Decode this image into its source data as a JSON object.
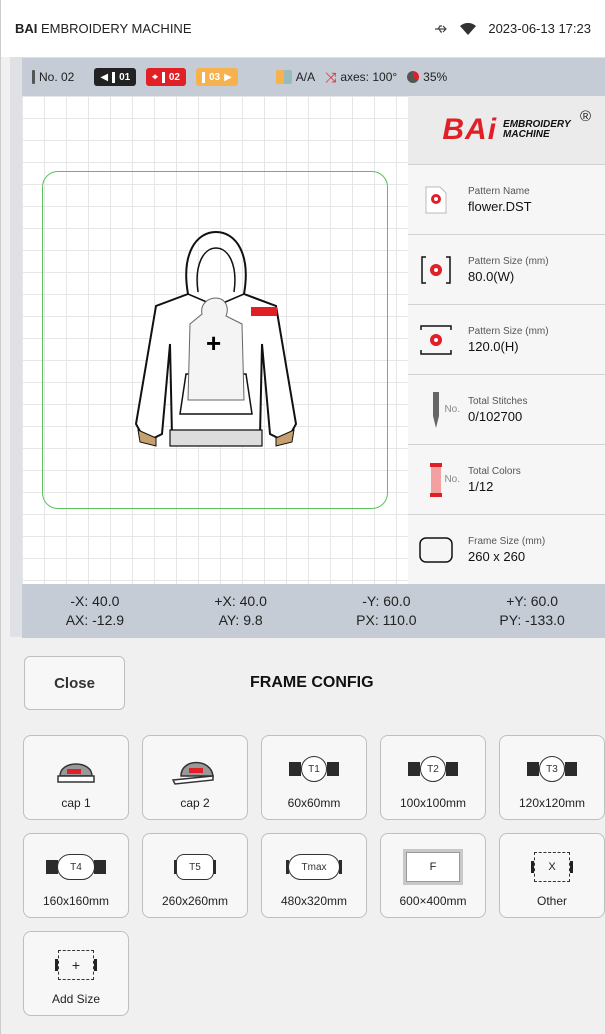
{
  "status": {
    "brand_bold": "BAI",
    "brand_rest": " EMBROIDERY MACHINE",
    "datetime": "2023-06-13 17:23",
    "icons": [
      "usb-icon",
      "wifi-icon"
    ]
  },
  "toolbar": {
    "needle_no": "No. 02",
    "prev_needle": "01",
    "current_needle": "02",
    "next_needle": "03",
    "mode": "A/A",
    "axes": "axes: 100°",
    "percent": "35%"
  },
  "panel": {
    "logo_text": "BAi",
    "logo_sub1": "EMBROIDERY",
    "logo_sub2": "MACHINE",
    "logo_reg": "®",
    "rows": [
      {
        "label": "Pattern Name",
        "value": "flower.DST"
      },
      {
        "label": "Pattern Size (mm)",
        "value": "80.0(W)"
      },
      {
        "label": "Pattern Size (mm)",
        "value": "120.0(H)"
      },
      {
        "label": "Total Stitches",
        "value": "0/102700",
        "tag": "No."
      },
      {
        "label": "Total Colors",
        "value": "1/12",
        "tag": "No."
      },
      {
        "label": "Frame Size (mm)",
        "value": "260 x 260"
      }
    ]
  },
  "coords": {
    "neg_x": "-X: 40.0",
    "pos_x": "+X: 40.0",
    "neg_y": "-Y: 60.0",
    "pos_y": "+Y: 60.0",
    "ax": "AX: -12.9",
    "ay": "AY: 9.8",
    "px": "PX: 110.0",
    "py": "PY: -133.0"
  },
  "frame_config": {
    "close_label": "Close",
    "title": "FRAME CONFIG",
    "buttons": [
      {
        "label": "cap 1",
        "icon": "cap-icon"
      },
      {
        "label": "cap 2",
        "icon": "cap-side-icon"
      },
      {
        "label": "60x60mm",
        "icon_text": "T1"
      },
      {
        "label": "100x100mm",
        "icon_text": "T2"
      },
      {
        "label": "120x120mm",
        "icon_text": "T3"
      },
      {
        "label": "160x160mm",
        "icon_text": "T4"
      },
      {
        "label": "260x260mm",
        "icon_text": "T5"
      },
      {
        "label": "480x320mm",
        "icon_text": "Tmax"
      },
      {
        "label": "600×400mm",
        "icon_text": "F"
      },
      {
        "label": "Other",
        "icon_text": "X"
      },
      {
        "label": "Add Size",
        "icon_text": "+"
      }
    ]
  },
  "colors": {
    "accent_red": "#e01f26",
    "hoop_green": "#5cc05c",
    "toolbar_bg": "#c5ccd6"
  }
}
